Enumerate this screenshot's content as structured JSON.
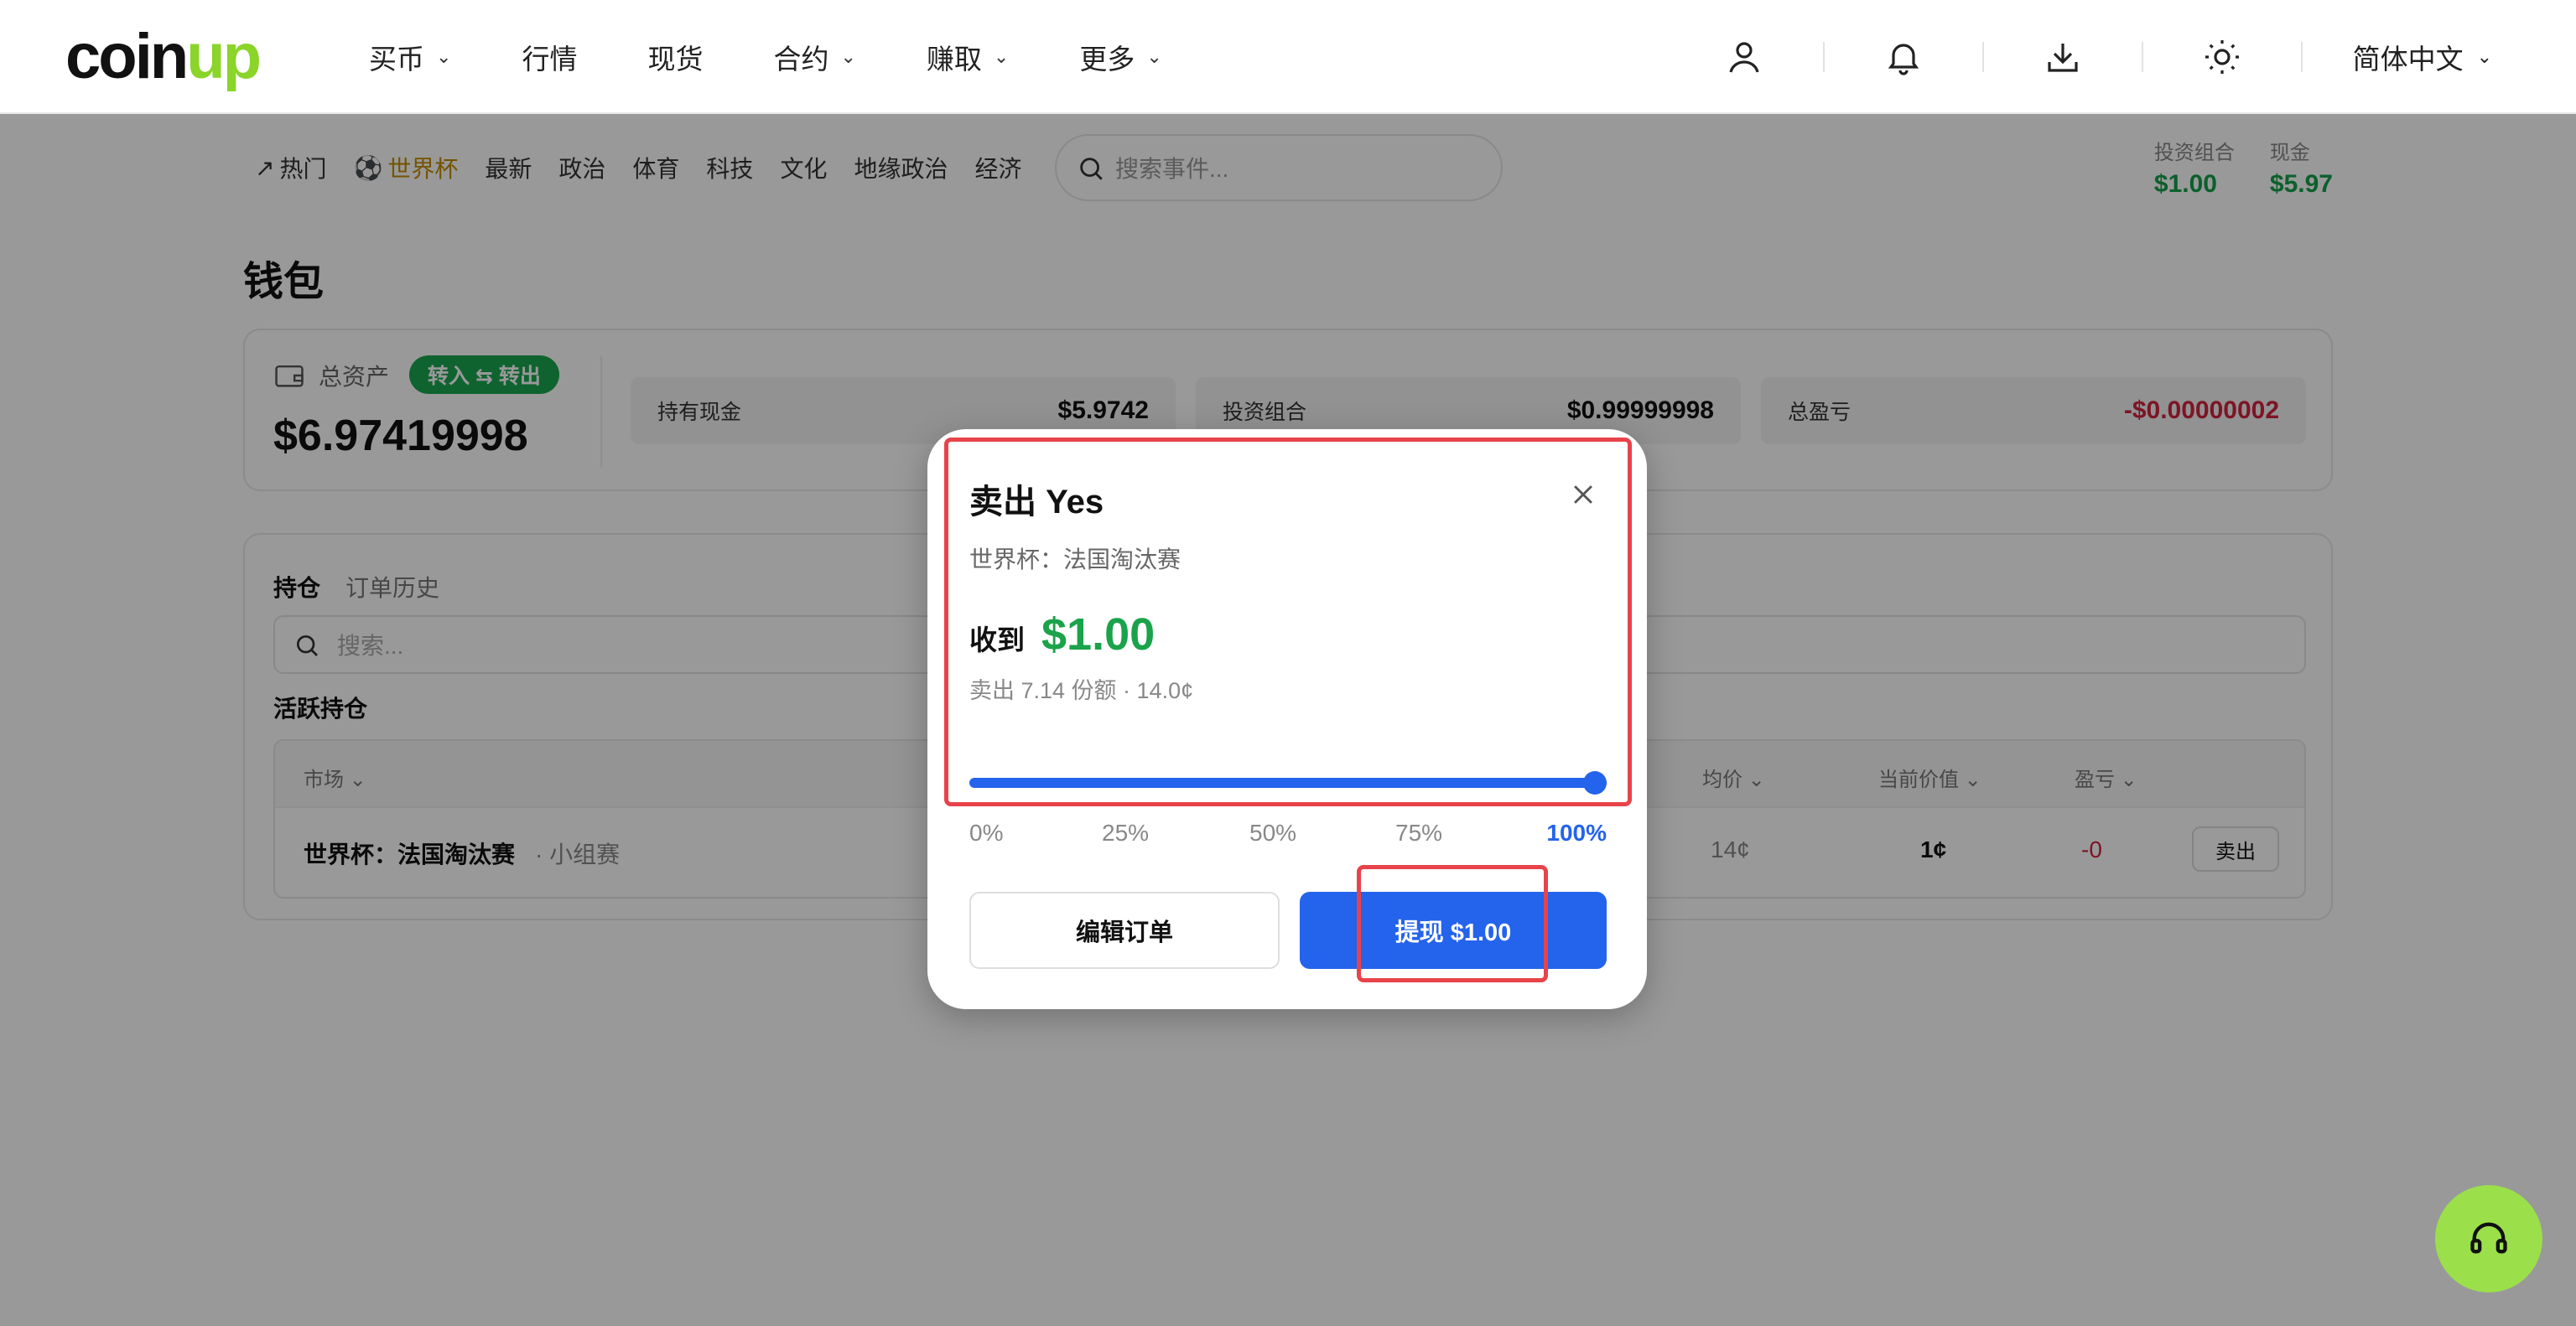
{
  "header": {
    "logo_main": "coin",
    "logo_accent": "up",
    "nav": [
      {
        "label": "买币",
        "has_dropdown": true
      },
      {
        "label": "行情",
        "has_dropdown": false
      },
      {
        "label": "现货",
        "has_dropdown": false
      },
      {
        "label": "合约",
        "has_dropdown": true
      },
      {
        "label": "赚取",
        "has_dropdown": true
      },
      {
        "label": "更多",
        "has_dropdown": true
      }
    ],
    "language": "简体中文",
    "icons": [
      "user-icon",
      "bell-icon",
      "download-icon",
      "sun-icon"
    ]
  },
  "categories": {
    "items": [
      "热门",
      "世界杯",
      "最新",
      "政治",
      "体育",
      "科技",
      "文化",
      "地缘政治",
      "经济"
    ],
    "active": "世界杯",
    "search_placeholder": "搜索事件..."
  },
  "balances": {
    "portfolio_label": "投资组合",
    "portfolio_value": "$1.00",
    "cash_label": "现金",
    "cash_value": "$5.97"
  },
  "wallet": {
    "title": "钱包",
    "total_label": "总资产",
    "inout_label": "转入 ⇆ 转出",
    "total_value": "$6.97419998",
    "metrics": [
      {
        "label": "持有现金",
        "value": "$5.9742"
      },
      {
        "label": "投资组合",
        "value": "$0.99999998"
      },
      {
        "label": "总盈亏",
        "value": "-$0.00000002"
      }
    ]
  },
  "positions": {
    "tabs": [
      "持仓",
      "订单历史"
    ],
    "search_placeholder": "搜索...",
    "active_title": "活跃持仓",
    "columns": [
      "市场",
      "均价",
      "当前价值",
      "盈亏"
    ],
    "rows": [
      {
        "market": "世界杯：法国淘汰赛",
        "market_tag": "· 小组赛",
        "avg": "14¢",
        "current": "1¢",
        "pnl": "-0",
        "action": "卖出"
      }
    ]
  },
  "modal": {
    "title": "卖出 Yes",
    "subtitle": "世界杯：法国淘汰赛",
    "receive_label": "收到",
    "receive_value": "$1.00",
    "detail": "卖出 7.14 份额 · 14.0¢",
    "slider_percent": 100,
    "ticks": [
      "0%",
      "25%",
      "50%",
      "75%",
      "100%"
    ],
    "edit_label": "编辑订单",
    "withdraw_label": "提现 $1.00"
  },
  "colors": {
    "accent_blue": "#2463eb",
    "positive_green": "#1aa34a",
    "negative_red": "#d0243d",
    "support_bg": "#9be04a"
  }
}
